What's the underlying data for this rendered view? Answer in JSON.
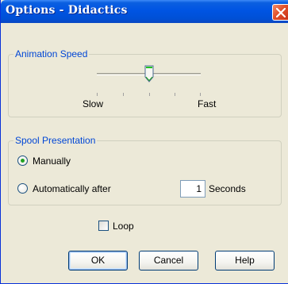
{
  "window": {
    "title": "Options - Didactics"
  },
  "animation_speed": {
    "group_label": "Animation Speed",
    "slow_label": "Slow",
    "fast_label": "Fast",
    "value_fraction": 0.5
  },
  "spool_presentation": {
    "group_label": "Spool Presentation",
    "manual_label": "Manually",
    "manual_selected": true,
    "auto_label": "Automatically after",
    "auto_selected": false,
    "seconds_value": "1",
    "seconds_label": "Seconds"
  },
  "loop": {
    "label": "Loop",
    "checked": false
  },
  "buttons": {
    "ok": "OK",
    "cancel": "Cancel",
    "help": "Help"
  },
  "colors": {
    "titlebar": "#0054e3",
    "dialog_bg": "#ece9d8",
    "group_label": "#0046d5",
    "radio_dot": "#21a121",
    "close_button": "#e0502a"
  }
}
